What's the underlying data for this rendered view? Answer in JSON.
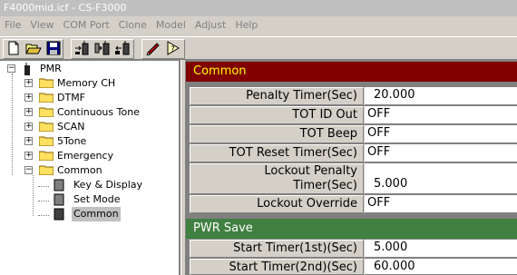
{
  "window": {
    "title": "F4000mid.icf - CS-F3000"
  },
  "menu": [
    "File",
    "View",
    "COM Port",
    "Clone",
    "Model",
    "Adjust",
    "Help"
  ],
  "toolbar": [
    "new-icon",
    "open-icon",
    "save-icon",
    "read-radio-icon",
    "write-radio-icon",
    "clone-radio-icon",
    "edit-icon",
    "help-icon"
  ],
  "tree": {
    "root": "PMR",
    "folders": [
      "Memory CH",
      "DTMF",
      "Continuous Tone",
      "SCAN",
      "5Tone",
      "Emergency",
      "Common"
    ],
    "common_children": [
      "Key & Display",
      "Set Mode",
      "Common"
    ],
    "selected": "Common"
  },
  "section_common": {
    "title": "Common",
    "rows": [
      {
        "label": "Penalty Timer(Sec)",
        "value": "20.000"
      },
      {
        "label": "TOT ID Out",
        "value": "OFF"
      },
      {
        "label": "TOT Beep",
        "value": "OFF"
      },
      {
        "label": "TOT Reset Timer(Sec)",
        "value": "OFF"
      },
      {
        "label1": "Lockout Penalty",
        "label2": "Timer(Sec)",
        "value": "5.000"
      },
      {
        "label": "Lockout Override",
        "value": "OFF"
      }
    ]
  },
  "section_pwr": {
    "title": "PWR Save",
    "rows": [
      {
        "label": "Start Timer(1st)(Sec)",
        "value": "5.000"
      },
      {
        "label": "Start Timer(2nd)(Sec)",
        "value": "60.000"
      }
    ]
  },
  "colors": {
    "section_common_bg": "#800000",
    "section_pwr_bg": "#408040",
    "section_text": "#ffff00"
  }
}
